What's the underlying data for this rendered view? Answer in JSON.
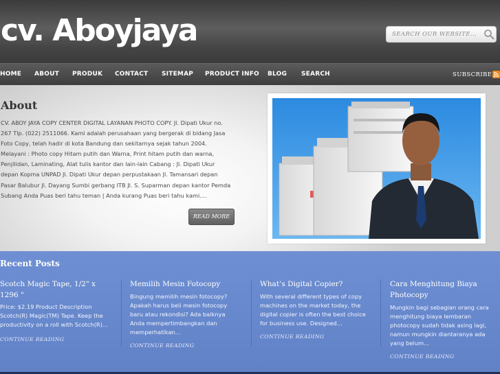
{
  "header": {
    "logo": "cv. Aboyjaya",
    "search_placeholder": "SEARCH OUR WEBSITE..."
  },
  "nav": {
    "items": [
      "HOME",
      "ABOUT",
      "PRODUK",
      "CONTACT",
      "SITEMAP",
      "PRODUCT INFO",
      "BLOG",
      "SEARCH"
    ],
    "subscribe": "SUBSCRIBE"
  },
  "featured": {
    "title": "About",
    "text": "CV. ABOY JAYA COPY CENTER DIGITAL LAYANAN PHOTO COPY. Jl. Dipati Ukur no. 267 Tlp. (022) 2511066. Kami adalah perusahaan yang bergerak di bidang Jasa Foto Copy, telah hadir di kota Bandung dan sekitarnya sejak tahun 2004. Melayani : Photo copy Hitam putih dan Warna, Print hitam putih dan warna, Penjilidan, Laminating, Alat tulis kantor dan lain-lain Cabang : Jl. Dipati Ukur depan Kopma UNPAD Jl. Dipati Ukur depan perpustakaan Jl. Tamansari depan Pasar Balubur Jl. Dayang Sumbi gerbang ITB Jl. S. Suparman depan kantor Pemda Subang Anda Puas beri tahu teman | Anda kurang Puas beri tahu kami....",
    "read_more": "READ MORE"
  },
  "recent": {
    "title": "Recent Posts",
    "posts": [
      {
        "title": "Scotch Magic Tape, 1/2\" x 1296 \"",
        "excerpt": "Price: $2.19    Product Description Scotch(R) Magic(TM) Tape. Keep the productivity on a roll with Scotch(R)...",
        "link": "CONTINUE READING"
      },
      {
        "title": "Memilih Mesin Fotocopy",
        "excerpt": "Bingung memilih mesin fotocopy? Apakah harus beli mesin fotocopy baru atau rekondisi? Ada baiknya Anda mempertimbangkan dan memperhatikan...",
        "link": "CONTINUE READING"
      },
      {
        "title": "What’s Digital Copier?",
        "excerpt": "With several different types of copy machines on the market today, the digital copier is often the best choice for business use. Designed...",
        "link": "CONTINUE READING"
      },
      {
        "title": "Cara Menghitung Biaya Photocopy",
        "excerpt": "Mungkin bagi sebagian orang cara menghitung biaya lembaran photocopy sudah tidak asing lagi, namun mungkin diantaranya ada yang belum...",
        "link": "CONTINUE READING"
      }
    ]
  },
  "colors": {
    "header_bg": "#4a4a4a",
    "recent_bg": "#6b8bd0",
    "rss": "#f28a1e"
  },
  "icons": [
    "search-icon",
    "rss-icon"
  ]
}
